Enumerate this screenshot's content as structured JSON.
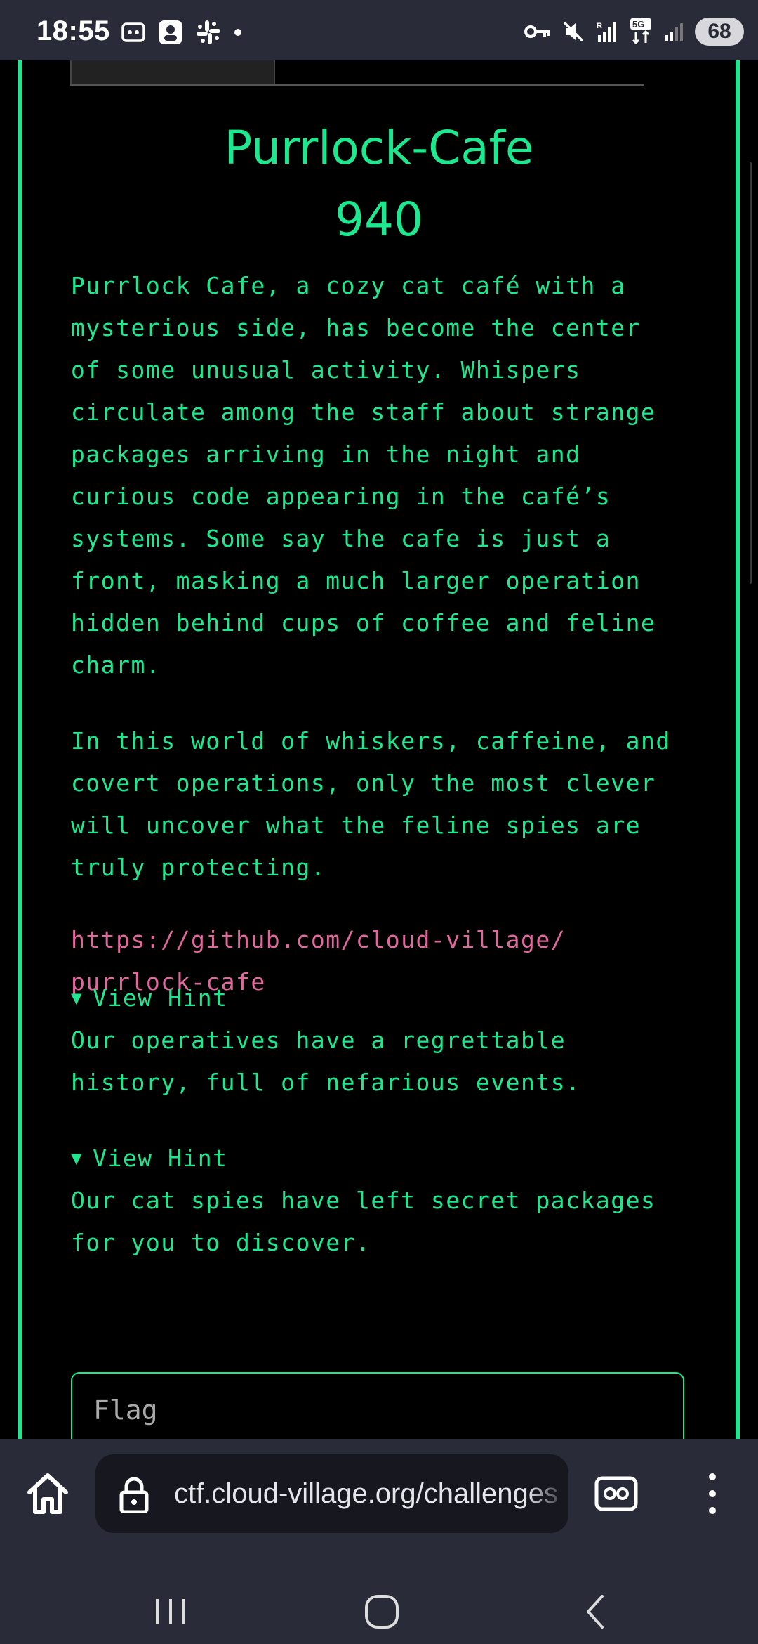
{
  "status_bar": {
    "time": "18:55",
    "battery": "68",
    "left_icons": [
      "screenshot-icon",
      "app-icon",
      "slack-icon",
      "dot-icon"
    ],
    "right_icons": [
      "vpn-key-icon",
      "mute-icon",
      "signal-r-icon",
      "5g-icon",
      "signal-icon"
    ]
  },
  "challenge": {
    "title": "Purrlock-Cafe",
    "points": "940",
    "description_lines": [
      "Purrlock Cafe, a cozy cat café with a",
      "mysterious side, has become the center",
      "of some unusual activity. Whispers",
      "circulate among the staff about strange",
      "packages arriving in the night and",
      "curious code appearing in the café’s",
      "systems. Some say the cafe is just a",
      "front, masking a much larger operation",
      "hidden behind cups of coffee and feline",
      "charm."
    ],
    "description2_lines": [
      "In this world of whiskers, caffeine, and",
      "covert operations, only the most clever",
      "will uncover what the feline spies are",
      "truly protecting."
    ],
    "link_lines": [
      "https://github.com/cloud-village/",
      "purrlock-cafe"
    ],
    "hints": [
      {
        "label": "View Hint",
        "lines": [
          "Our operatives have a regrettable",
          "history, full of nefarious events."
        ]
      },
      {
        "label": "View Hint",
        "lines": [
          "Our cat spies have left secret packages",
          "for you to discover."
        ]
      }
    ],
    "flag_placeholder": "Flag"
  },
  "browser": {
    "url": "ctf.cloud-village.org/challenges"
  },
  "colors": {
    "accent": "#1ee88f",
    "link": "#e0689d",
    "bar_bg": "#2a2b38"
  }
}
